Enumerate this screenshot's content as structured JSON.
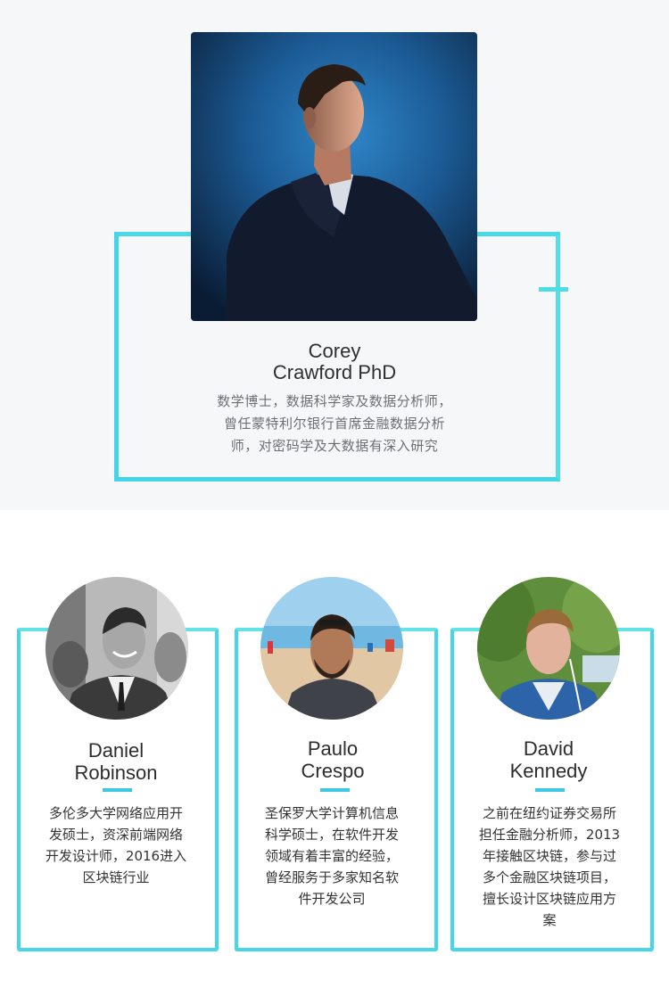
{
  "featured": {
    "name_line1": "Corey",
    "name_line2": "Crawford PhD",
    "desc_line1": "数学博士，数据科学家及数据分析师，",
    "desc_line2": "曾任蒙特利尔银行首席金融数据分析",
    "desc_line3": "师，对密码学及大数据有深入研究"
  },
  "team": [
    {
      "name_line1": "Daniel",
      "name_line2": "Robinson",
      "desc_lines": [
        "多伦多大学网络应用开",
        "发硕士，资深前端网络",
        "开发设计师，2016进入",
        "区块链行业"
      ]
    },
    {
      "name_line1": "Paulo",
      "name_line2": "Crespo",
      "desc_lines": [
        "圣保罗大学计算机信息",
        "科学硕士，在软件开发",
        "领域有着丰富的经验，",
        "曾经服务于多家知名软",
        "件开发公司"
      ]
    },
    {
      "name_line1": "David",
      "name_line2": "Kennedy",
      "desc_lines": [
        "之前在纽约证券交易所",
        "担任金融分析师，2013",
        "年接触区块链，参与过",
        "多个金融区块链项目，",
        "擅长设计区块链应用方",
        "案"
      ]
    }
  ],
  "colors": {
    "frame": "#42d4e9",
    "accent": "#3ec7e3",
    "top_bg": "#f6f7f9"
  }
}
